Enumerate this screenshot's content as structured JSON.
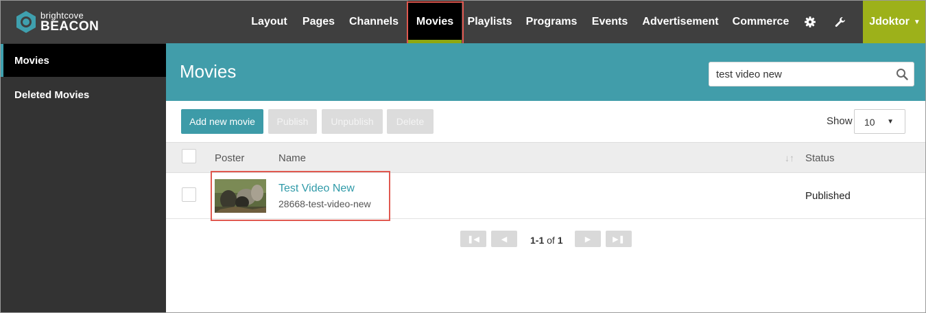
{
  "brand": {
    "small": "brightcove",
    "big": "BEACON",
    "accent": "#3fa0ae"
  },
  "nav": {
    "items": [
      {
        "label": "Layout"
      },
      {
        "label": "Pages"
      },
      {
        "label": "Channels"
      },
      {
        "label": "Movies",
        "active": true
      },
      {
        "label": "Playlists"
      },
      {
        "label": "Programs"
      },
      {
        "label": "Events"
      },
      {
        "label": "Advertisement"
      },
      {
        "label": "Commerce"
      }
    ],
    "settings_icon": "gear-icon",
    "tools_icon": "wrench-icon",
    "user": "Jdoktor",
    "user_color": "#9db11a"
  },
  "sidebar": {
    "items": [
      {
        "label": "Movies",
        "active": true
      },
      {
        "label": "Deleted Movies"
      }
    ]
  },
  "main": {
    "title": "Movies",
    "search_value": "test video new",
    "buttons": {
      "add": "Add new movie",
      "publish": "Publish",
      "unpublish": "Unpublish",
      "delete": "Delete"
    },
    "show_label": "Show",
    "show_value": "10",
    "columns": {
      "poster": "Poster",
      "name": "Name",
      "status": "Status"
    },
    "rows": [
      {
        "name": "Test Video New",
        "slug": "28668-test-video-new",
        "status": "Published"
      }
    ],
    "pagination": {
      "range": "1-1",
      "of": "of",
      "total": "1"
    }
  }
}
